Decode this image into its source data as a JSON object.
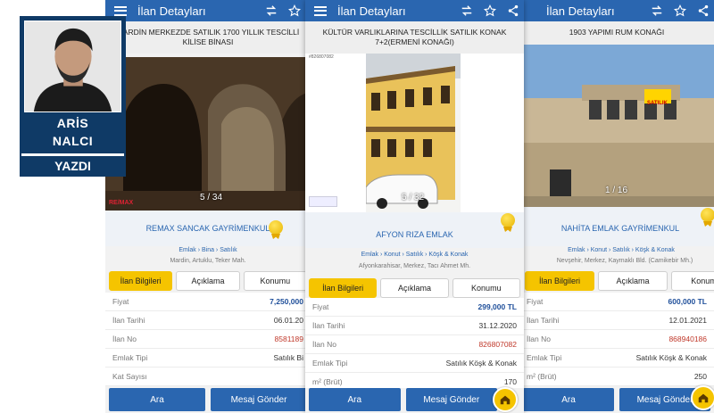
{
  "author": {
    "first": "ARİS",
    "last": "NALCI",
    "label": "YAZDI"
  },
  "app_title": "İlan Detayları",
  "icons": {
    "menu": "menu-icon",
    "compare": "swap-icon",
    "favorite": "star-icon",
    "share": "share-icon",
    "home": "home-icon"
  },
  "colors": {
    "appbar": "#2a66b0",
    "accent": "#f5c400",
    "price": "#1f4f9a"
  },
  "listings": [
    {
      "headline": "MARDİN MERKEZDE SATILIK 1700 YILLIK TESCİLLİ KİLİSE BİNASI",
      "photo_counter": "5 / 34",
      "watermark": "RE/MAX",
      "agency": "REMAX SANCAK GAYRİMENKUL",
      "breadcrumb": "Emlak › Bina › Satılık",
      "location": "Mardin, Artuklu, Teker Mah.",
      "tabs": [
        "İlan Bilgileri",
        "Açıklama",
        "Konumu"
      ],
      "rows": [
        {
          "k": "Fiyat",
          "v": "7,250,000"
        },
        {
          "k": "İlan Tarihi",
          "v": "06.01.20"
        },
        {
          "k": "İlan No",
          "v": "8581189"
        },
        {
          "k": "Emlak Tipi",
          "v": "Satılık Bi"
        },
        {
          "k": "Kat Sayısı",
          "v": ""
        }
      ],
      "buttons": [
        "Ara",
        "Mesaj Gönder"
      ]
    },
    {
      "headline": "KÜLTÜR VARLIKLARINA TESCİLLİK SATILIK KONAK 7+2(ERMENİ KONAĞI)",
      "photo_id": "#826807082",
      "photo_counter": "5 / 32",
      "agency": "AFYON RIZA EMLAK",
      "breadcrumb": "Emlak › Konut › Satılık › Köşk & Konak",
      "location": "Afyonkarahisar, Merkez, Tacı Ahmet Mh.",
      "tabs": [
        "İlan Bilgileri",
        "Açıklama",
        "Konumu"
      ],
      "rows": [
        {
          "k": "Fiyat",
          "v": "299,000 TL"
        },
        {
          "k": "İlan Tarihi",
          "v": "31.12.2020"
        },
        {
          "k": "İlan No",
          "v": "826807082"
        },
        {
          "k": "Emlak Tipi",
          "v": "Satılık Köşk & Konak"
        },
        {
          "k": "m² (Brüt)",
          "v": "170"
        }
      ],
      "buttons": [
        "Ara",
        "Mesaj Gönder"
      ]
    },
    {
      "headline": "1903 YAPIMI RUM KONAĞI",
      "photo_counter": "1 / 16",
      "sign_text": "SATILIK",
      "agency": "NAHİTA EMLAK GAYRİMENKUL",
      "breadcrumb": "Emlak › Konut › Satılık › Köşk & Konak",
      "location": "Nevşehir, Merkez, Kaymaklı Bld. (Camikebir Mh.)",
      "tabs": [
        "İlan Bilgileri",
        "Açıklama",
        "Konumu"
      ],
      "rows": [
        {
          "k": "Fiyat",
          "v": "600,000 TL"
        },
        {
          "k": "İlan Tarihi",
          "v": "12.01.2021"
        },
        {
          "k": "İlan No",
          "v": "868940186"
        },
        {
          "k": "Emlak Tipi",
          "v": "Satılık Köşk & Konak"
        },
        {
          "k": "m² (Brüt)",
          "v": "250"
        }
      ],
      "buttons": [
        "Ara",
        "Mesaj Gönder"
      ]
    }
  ]
}
